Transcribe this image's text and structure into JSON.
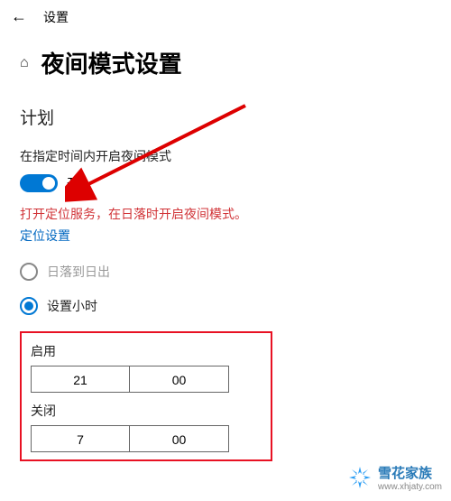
{
  "header": {
    "title": "设置"
  },
  "page": {
    "title": "夜间模式设置"
  },
  "schedule": {
    "heading": "计划",
    "desc": "在指定时间内开启夜间模式",
    "toggle_state": "开",
    "warning": "打开定位服务，在日落时开启夜间模式。",
    "location_link": "定位设置",
    "option_sunset": "日落到日出",
    "option_hours": "设置小时",
    "on_label": "启用",
    "on_hour": "21",
    "on_minute": "00",
    "off_label": "关闭",
    "off_hour": "7",
    "off_minute": "00"
  },
  "watermark": {
    "name": "雪花家族",
    "url": "www.xhjaty.com"
  }
}
